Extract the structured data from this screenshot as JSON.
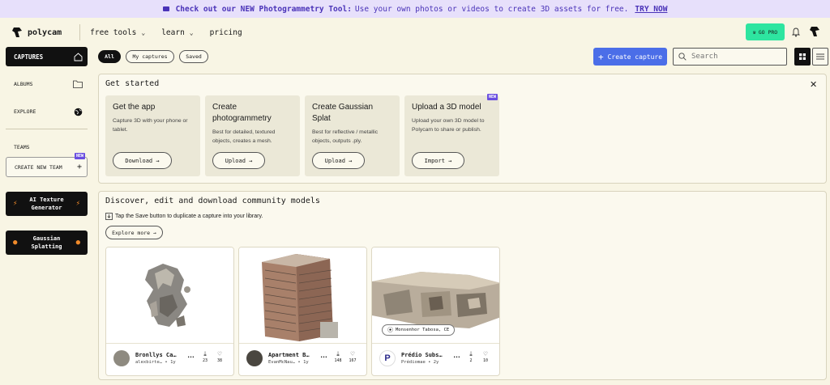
{
  "banner": {
    "lead": "Check out our NEW Photogrammetry Tool:",
    "body": "Use your own photos or videos to create 3D assets for free.",
    "cta": "TRY NOW"
  },
  "nav": {
    "brand": "polycam",
    "links": [
      {
        "label": "free tools"
      },
      {
        "label": "learn"
      },
      {
        "label": "pricing"
      }
    ],
    "go_pro": "GO PRO"
  },
  "sidebar": {
    "captures": "CAPTURES",
    "albums": "ALBUMS",
    "explore": "EXPLORE",
    "teams": "TEAMS",
    "create_team": "CREATE NEW TEAM",
    "new_badge": "NEW",
    "ai_texture": "AI Texture Generator",
    "gaussian": "Gaussian Splatting"
  },
  "filters": {
    "all": "All",
    "my_captures": "My captures",
    "saved": "Saved"
  },
  "toolbar": {
    "create_capture": "Create capture",
    "search_placeholder": "Search"
  },
  "get_started": {
    "title": "Get started",
    "new_badge": "NEW",
    "cards": [
      {
        "title": "Get the app",
        "desc": "Capture 3D with your phone or tablet.",
        "button": "Download →"
      },
      {
        "title": "Create photogrammetry",
        "desc": "Best for detailed, textured objects, creates a mesh.",
        "button": "Upload →"
      },
      {
        "title": "Create Gaussian Splat",
        "desc": "Best for reflective / metallic objects, outputs .ply.",
        "button": "Upload →"
      },
      {
        "title": "Upload a 3D model",
        "desc": "Upload your own 3D model to Polycam to share or publish.",
        "button": "Import →"
      }
    ]
  },
  "community": {
    "title": "Discover, edit and download community models",
    "subtitle": "Tap the Save button to duplicate a capture into your library.",
    "explore": "Explore more →",
    "models": [
      {
        "name": "Bronllys Ca…",
        "author": "alexbirte…",
        "age": "1y",
        "downloads": "23",
        "likes": "38"
      },
      {
        "name": "Apartment B…",
        "author": "EvanMcNau…",
        "age": "1y",
        "downloads": "148",
        "likes": "167"
      },
      {
        "name": "Prédio Subs…",
        "author": "Prédiomae",
        "age": "2y",
        "downloads": "2",
        "likes": "10",
        "location": "Monsenhor Tabosa, CE"
      }
    ]
  },
  "colors": {
    "background": "#f8f5e4",
    "banner": "#e7e0fb",
    "accent_blue": "#4b6ee8",
    "go_pro_green": "#2ee5a0",
    "new_badge": "#6a4ee0"
  }
}
